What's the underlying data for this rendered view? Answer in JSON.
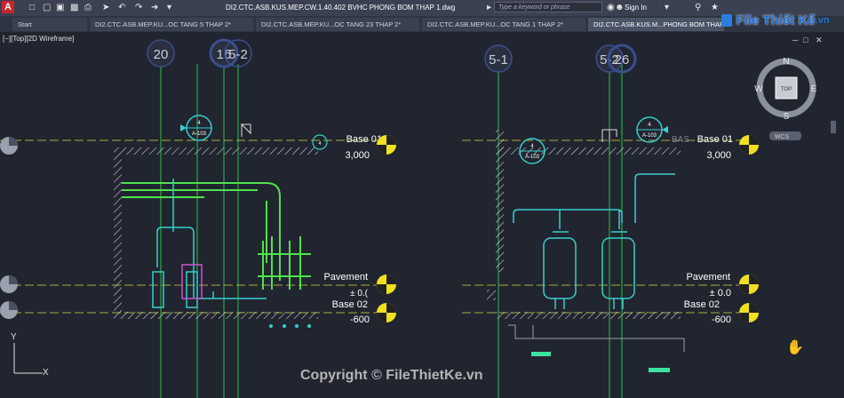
{
  "app": {
    "logo": "A",
    "title": "DI2.CTC.ASB.KUS.MEP.CW.1.40.402 BVHC PHONG BOM THAP 1.dwg"
  },
  "search": {
    "placeholder": "Type a keyword or phrase"
  },
  "account": {
    "sign_in": "Sign In"
  },
  "tabs": [
    {
      "label": "Start"
    },
    {
      "label": "DI2.CTC.ASB.MEP.KU...OC TANG 5 THAP 2*"
    },
    {
      "label": "DI2.CTC.ASB.MEP.KU...OC TANG 23 THAP 2*"
    },
    {
      "label": "DI2.CTC.ASB.MEP.KU...OC TANG 1 THAP 2*"
    },
    {
      "label": "DI2.CTC.ASB.KUS.M...PHONG BOM THAP"
    }
  ],
  "viewport": {
    "label": "[−][Top][2D Wireframe]"
  },
  "viewcube": {
    "north": "N",
    "south": "S",
    "east": "E",
    "west": "W",
    "face": "TOP",
    "ucs": "WCS"
  },
  "grid_bubbles": [
    "20",
    "16",
    "5-2",
    "5-1",
    "5-2",
    "26"
  ],
  "section_markers": [
    {
      "top": "4",
      "bottom": "A-103"
    },
    {
      "top": "4",
      "bottom": "A-103"
    },
    {
      "top": "4",
      "bottom": "A-103"
    },
    {
      "top": "4",
      "bottom": "A-103"
    }
  ],
  "levels": [
    {
      "name": "Base 01",
      "value": "3,000"
    },
    {
      "name": "Pavement",
      "value": "± 0.0"
    },
    {
      "name": "Base 02",
      "value": "-600"
    },
    {
      "name": "Base 01",
      "value": "3,000"
    },
    {
      "name": "Pavement",
      "value": "± 0.0"
    },
    {
      "name": "Base 02",
      "value": "-600"
    }
  ],
  "level_value_prefix": "± 0.(",
  "side_text": "BAS",
  "ucs_axes": {
    "y": "Y",
    "x": "X"
  },
  "watermark": {
    "brand": "File Thiết Kế",
    "domain": ".vn",
    "copyright": "Copyright © FileThietKe.vn"
  },
  "colors": {
    "background": "#21252f",
    "accent_yellow": "#f0e020",
    "cyan": "#35d0d0",
    "green": "#3ee23e",
    "magenta": "#d050d0"
  }
}
